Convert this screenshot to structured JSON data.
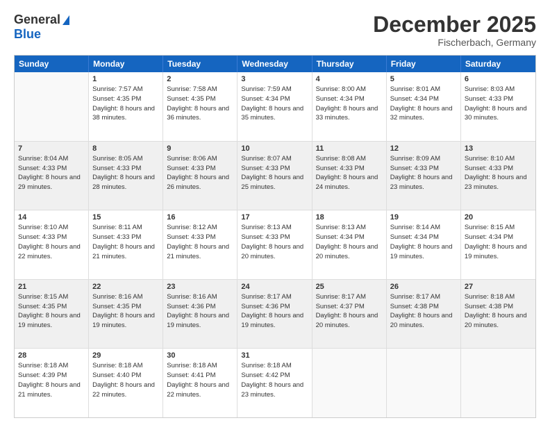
{
  "header": {
    "logo_general": "General",
    "logo_blue": "Blue",
    "month": "December 2025",
    "location": "Fischerbach, Germany"
  },
  "weekdays": [
    "Sunday",
    "Monday",
    "Tuesday",
    "Wednesday",
    "Thursday",
    "Friday",
    "Saturday"
  ],
  "weeks": [
    [
      {
        "day": "",
        "sunrise": "",
        "sunset": "",
        "daylight": "",
        "empty": true
      },
      {
        "day": "1",
        "sunrise": "Sunrise: 7:57 AM",
        "sunset": "Sunset: 4:35 PM",
        "daylight": "Daylight: 8 hours and 38 minutes.",
        "empty": false
      },
      {
        "day": "2",
        "sunrise": "Sunrise: 7:58 AM",
        "sunset": "Sunset: 4:35 PM",
        "daylight": "Daylight: 8 hours and 36 minutes.",
        "empty": false
      },
      {
        "day": "3",
        "sunrise": "Sunrise: 7:59 AM",
        "sunset": "Sunset: 4:34 PM",
        "daylight": "Daylight: 8 hours and 35 minutes.",
        "empty": false
      },
      {
        "day": "4",
        "sunrise": "Sunrise: 8:00 AM",
        "sunset": "Sunset: 4:34 PM",
        "daylight": "Daylight: 8 hours and 33 minutes.",
        "empty": false
      },
      {
        "day": "5",
        "sunrise": "Sunrise: 8:01 AM",
        "sunset": "Sunset: 4:34 PM",
        "daylight": "Daylight: 8 hours and 32 minutes.",
        "empty": false
      },
      {
        "day": "6",
        "sunrise": "Sunrise: 8:03 AM",
        "sunset": "Sunset: 4:33 PM",
        "daylight": "Daylight: 8 hours and 30 minutes.",
        "empty": false
      }
    ],
    [
      {
        "day": "7",
        "sunrise": "Sunrise: 8:04 AM",
        "sunset": "Sunset: 4:33 PM",
        "daylight": "Daylight: 8 hours and 29 minutes.",
        "empty": false
      },
      {
        "day": "8",
        "sunrise": "Sunrise: 8:05 AM",
        "sunset": "Sunset: 4:33 PM",
        "daylight": "Daylight: 8 hours and 28 minutes.",
        "empty": false
      },
      {
        "day": "9",
        "sunrise": "Sunrise: 8:06 AM",
        "sunset": "Sunset: 4:33 PM",
        "daylight": "Daylight: 8 hours and 26 minutes.",
        "empty": false
      },
      {
        "day": "10",
        "sunrise": "Sunrise: 8:07 AM",
        "sunset": "Sunset: 4:33 PM",
        "daylight": "Daylight: 8 hours and 25 minutes.",
        "empty": false
      },
      {
        "day": "11",
        "sunrise": "Sunrise: 8:08 AM",
        "sunset": "Sunset: 4:33 PM",
        "daylight": "Daylight: 8 hours and 24 minutes.",
        "empty": false
      },
      {
        "day": "12",
        "sunrise": "Sunrise: 8:09 AM",
        "sunset": "Sunset: 4:33 PM",
        "daylight": "Daylight: 8 hours and 23 minutes.",
        "empty": false
      },
      {
        "day": "13",
        "sunrise": "Sunrise: 8:10 AM",
        "sunset": "Sunset: 4:33 PM",
        "daylight": "Daylight: 8 hours and 23 minutes.",
        "empty": false
      }
    ],
    [
      {
        "day": "14",
        "sunrise": "Sunrise: 8:10 AM",
        "sunset": "Sunset: 4:33 PM",
        "daylight": "Daylight: 8 hours and 22 minutes.",
        "empty": false
      },
      {
        "day": "15",
        "sunrise": "Sunrise: 8:11 AM",
        "sunset": "Sunset: 4:33 PM",
        "daylight": "Daylight: 8 hours and 21 minutes.",
        "empty": false
      },
      {
        "day": "16",
        "sunrise": "Sunrise: 8:12 AM",
        "sunset": "Sunset: 4:33 PM",
        "daylight": "Daylight: 8 hours and 21 minutes.",
        "empty": false
      },
      {
        "day": "17",
        "sunrise": "Sunrise: 8:13 AM",
        "sunset": "Sunset: 4:33 PM",
        "daylight": "Daylight: 8 hours and 20 minutes.",
        "empty": false
      },
      {
        "day": "18",
        "sunrise": "Sunrise: 8:13 AM",
        "sunset": "Sunset: 4:34 PM",
        "daylight": "Daylight: 8 hours and 20 minutes.",
        "empty": false
      },
      {
        "day": "19",
        "sunrise": "Sunrise: 8:14 AM",
        "sunset": "Sunset: 4:34 PM",
        "daylight": "Daylight: 8 hours and 19 minutes.",
        "empty": false
      },
      {
        "day": "20",
        "sunrise": "Sunrise: 8:15 AM",
        "sunset": "Sunset: 4:34 PM",
        "daylight": "Daylight: 8 hours and 19 minutes.",
        "empty": false
      }
    ],
    [
      {
        "day": "21",
        "sunrise": "Sunrise: 8:15 AM",
        "sunset": "Sunset: 4:35 PM",
        "daylight": "Daylight: 8 hours and 19 minutes.",
        "empty": false
      },
      {
        "day": "22",
        "sunrise": "Sunrise: 8:16 AM",
        "sunset": "Sunset: 4:35 PM",
        "daylight": "Daylight: 8 hours and 19 minutes.",
        "empty": false
      },
      {
        "day": "23",
        "sunrise": "Sunrise: 8:16 AM",
        "sunset": "Sunset: 4:36 PM",
        "daylight": "Daylight: 8 hours and 19 minutes.",
        "empty": false
      },
      {
        "day": "24",
        "sunrise": "Sunrise: 8:17 AM",
        "sunset": "Sunset: 4:36 PM",
        "daylight": "Daylight: 8 hours and 19 minutes.",
        "empty": false
      },
      {
        "day": "25",
        "sunrise": "Sunrise: 8:17 AM",
        "sunset": "Sunset: 4:37 PM",
        "daylight": "Daylight: 8 hours and 20 minutes.",
        "empty": false
      },
      {
        "day": "26",
        "sunrise": "Sunrise: 8:17 AM",
        "sunset": "Sunset: 4:38 PM",
        "daylight": "Daylight: 8 hours and 20 minutes.",
        "empty": false
      },
      {
        "day": "27",
        "sunrise": "Sunrise: 8:18 AM",
        "sunset": "Sunset: 4:38 PM",
        "daylight": "Daylight: 8 hours and 20 minutes.",
        "empty": false
      }
    ],
    [
      {
        "day": "28",
        "sunrise": "Sunrise: 8:18 AM",
        "sunset": "Sunset: 4:39 PM",
        "daylight": "Daylight: 8 hours and 21 minutes.",
        "empty": false
      },
      {
        "day": "29",
        "sunrise": "Sunrise: 8:18 AM",
        "sunset": "Sunset: 4:40 PM",
        "daylight": "Daylight: 8 hours and 22 minutes.",
        "empty": false
      },
      {
        "day": "30",
        "sunrise": "Sunrise: 8:18 AM",
        "sunset": "Sunset: 4:41 PM",
        "daylight": "Daylight: 8 hours and 22 minutes.",
        "empty": false
      },
      {
        "day": "31",
        "sunrise": "Sunrise: 8:18 AM",
        "sunset": "Sunset: 4:42 PM",
        "daylight": "Daylight: 8 hours and 23 minutes.",
        "empty": false
      },
      {
        "day": "",
        "sunrise": "",
        "sunset": "",
        "daylight": "",
        "empty": true
      },
      {
        "day": "",
        "sunrise": "",
        "sunset": "",
        "daylight": "",
        "empty": true
      },
      {
        "day": "",
        "sunrise": "",
        "sunset": "",
        "daylight": "",
        "empty": true
      }
    ]
  ]
}
